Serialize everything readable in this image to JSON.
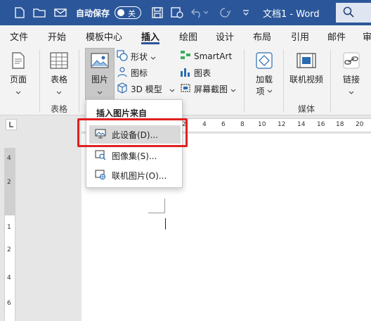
{
  "titlebar": {
    "autosave_label": "自动保存",
    "autosave_state": "关",
    "doc_title": "文档1 - Word",
    "colors": {
      "accent": "#2b579a"
    }
  },
  "tabs": [
    {
      "label": "文件"
    },
    {
      "label": "开始"
    },
    {
      "label": "模板中心"
    },
    {
      "label": "插入"
    },
    {
      "label": "绘图"
    },
    {
      "label": "设计"
    },
    {
      "label": "布局"
    },
    {
      "label": "引用"
    },
    {
      "label": "邮件"
    },
    {
      "label": "审"
    }
  ],
  "ribbon": {
    "page_btn": "页面",
    "table_btn": "表格",
    "picture_btn": "图片",
    "shapes": "形状",
    "icons": "图标",
    "model3d": "3D 模型",
    "smartart": "SmartArt",
    "chart": "图表",
    "screenshot": "屏幕截图",
    "addins": "加载",
    "addins2": "项",
    "online_video": "联机视频",
    "link": "链接",
    "group_table": "表格",
    "group_media": "媒体"
  },
  "ruler": {
    "h_numbers": [
      "2",
      "4",
      "6",
      "8",
      "10",
      "12",
      "14",
      "16",
      "18",
      "20"
    ],
    "v_numbers": [
      "4",
      "2",
      "1",
      "2",
      "4",
      "6"
    ]
  },
  "dropdown": {
    "header": "插入图片来自",
    "items": [
      {
        "label": "此设备(D)..."
      },
      {
        "label": "图像集(S)..."
      },
      {
        "label": "联机图片(O)..."
      }
    ]
  }
}
